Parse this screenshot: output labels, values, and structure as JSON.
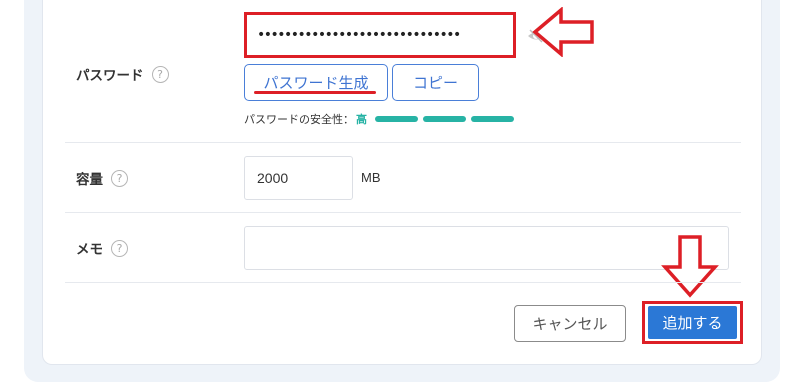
{
  "form": {
    "password": {
      "label": "パスワード",
      "value": "••••••••••••••••••••••••••••••",
      "generate_label": "パスワード生成",
      "copy_label": "コピー",
      "strength_label": "パスワードの安全性：",
      "strength_value": "高",
      "strength_segments": 3
    },
    "capacity": {
      "label": "容量",
      "value": "2000",
      "unit": "MB"
    },
    "memo": {
      "label": "メモ",
      "value": ""
    },
    "help_glyph": "?"
  },
  "actions": {
    "cancel_label": "キャンセル",
    "add_label": "追加する"
  },
  "colors": {
    "annotation_red": "#dd1f26",
    "primary_blue": "#2b78d6",
    "strength_teal": "#27b3a5"
  },
  "icons": {
    "password_visibility": "eye-icon",
    "help": "question-circle-icon",
    "annotation_left": "arrow-left-icon",
    "annotation_down": "arrow-down-icon"
  }
}
